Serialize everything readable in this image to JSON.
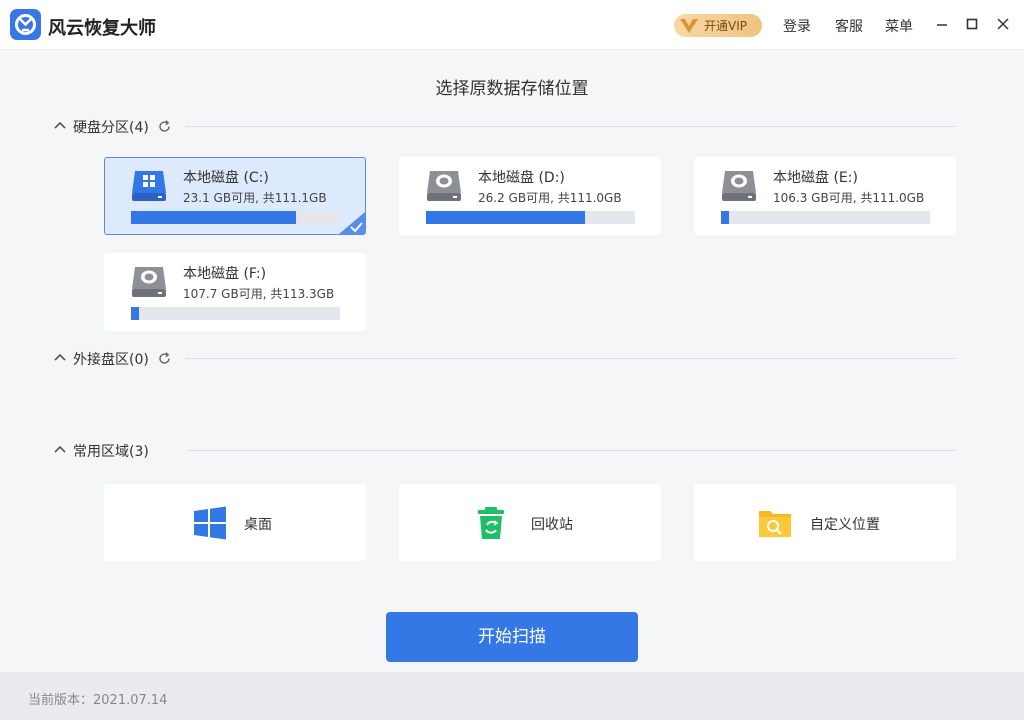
{
  "app": {
    "title": "风云恢复大师"
  },
  "header": {
    "vip_label": "开通VIP",
    "login": "登录",
    "service": "客服",
    "menu": "菜单"
  },
  "page_title": "选择原数据存储位置",
  "sections": {
    "disks": {
      "label": "硬盘分区(4)"
    },
    "external": {
      "label": "外接盘区(0)"
    },
    "common": {
      "label": "常用区域(3)"
    }
  },
  "disks": [
    {
      "name": "本地磁盘 (C:)",
      "space": "23.1 GB可用, 共111.1GB",
      "used_fraction": 0.79,
      "selected": true
    },
    {
      "name": "本地磁盘 (D:)",
      "space": "26.2 GB可用, 共111.0GB",
      "used_fraction": 0.76,
      "selected": false
    },
    {
      "name": "本地磁盘 (E:)",
      "space": "106.3 GB可用, 共111.0GB",
      "used_fraction": 0.04,
      "selected": false
    },
    {
      "name": "本地磁盘 (F:)",
      "space": "107.7 GB可用, 共113.3GB",
      "used_fraction": 0.04,
      "selected": false
    }
  ],
  "common_areas": [
    {
      "label": "桌面",
      "icon": "windows-icon"
    },
    {
      "label": "回收站",
      "icon": "recycle-bin-icon"
    },
    {
      "label": "自定义位置",
      "icon": "folder-search-icon"
    }
  ],
  "start_button": "开始扫描",
  "footer": {
    "version": "当前版本：2021.07.14"
  },
  "colors": {
    "accent": "#3478e5",
    "selected_bg": "#dde9fd",
    "vip_gold": "#f0c27e"
  }
}
